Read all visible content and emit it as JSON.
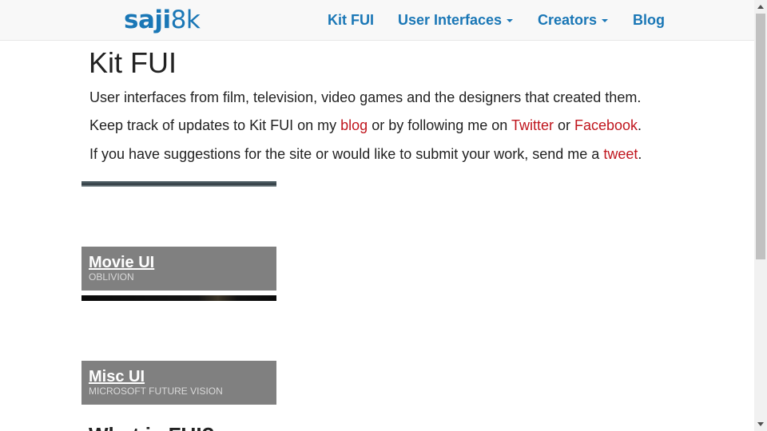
{
  "brand": {
    "part1": "saji",
    "part2": "8k"
  },
  "nav": {
    "items": [
      {
        "label": "Kit FUI",
        "dropdown": false
      },
      {
        "label": "User Interfaces",
        "dropdown": true
      },
      {
        "label": "Creators",
        "dropdown": true
      },
      {
        "label": "Blog",
        "dropdown": false
      }
    ]
  },
  "main": {
    "title": "Kit FUI",
    "intro": "User interfaces from film, television, video games and the designers that created them.",
    "updates": {
      "text1": "Keep track of updates to Kit FUI on my ",
      "link_blog": "blog",
      "text2": " or by following me on ",
      "link_twitter": "Twitter",
      "text3": " or ",
      "link_facebook": "Facebook",
      "text4": "."
    },
    "suggest": {
      "text1": "If you have suggestions for the site or would like to submit your work, send me a ",
      "link_tweet": "tweet",
      "text2": "."
    },
    "cards": [
      {
        "title": "Movie UI",
        "subtitle": "OBLIVION"
      },
      {
        "title": "Misc UI",
        "subtitle": "MICROSOFT FUTURE VISION"
      }
    ],
    "next_heading": "What is FUI?"
  },
  "colors": {
    "brand_blue": "#1a77b6",
    "link_red": "#c0161e",
    "caption_gray": "#808080"
  }
}
